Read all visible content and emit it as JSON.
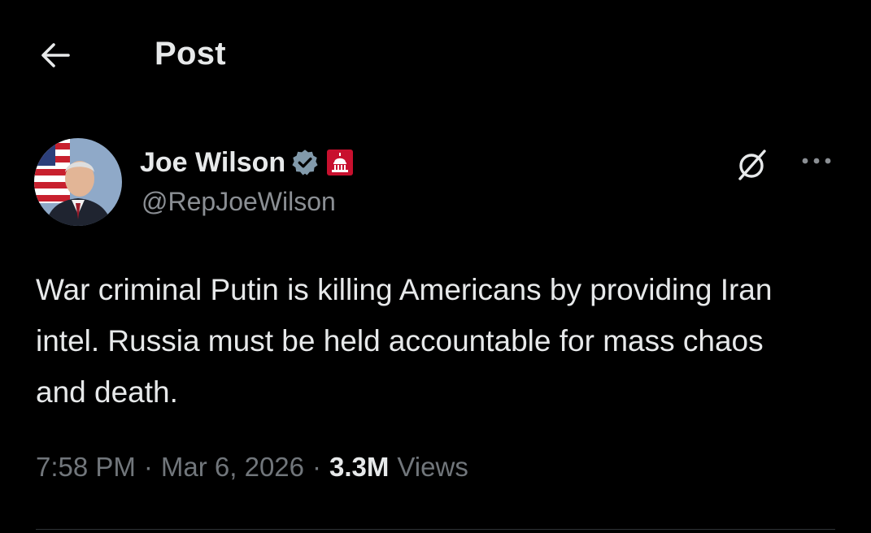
{
  "header": {
    "title": "Post",
    "back_icon": "arrow-left-icon"
  },
  "author": {
    "display_name": "Joe Wilson",
    "handle": "@RepJoeWilson",
    "verified_icon": "verified-badge-icon",
    "affiliation_icon": "us-capitol-badge-icon",
    "colors": {
      "verified_badge": "#829aab",
      "affiliation_badge": "#c8102e"
    }
  },
  "actions": {
    "grok_icon": "grok-icon",
    "more_icon": "more-horizontal-icon"
  },
  "post": {
    "text": "War criminal Putin is killing Americans by providing Iran intel. Russia must be held accountable for mass chaos and death."
  },
  "meta": {
    "time": "7:58 PM",
    "date": "Mar 6, 2026",
    "separator": "·",
    "views_count": "3.3M",
    "views_label": "Views"
  },
  "theme": {
    "background": "#000000",
    "text_primary": "#e7e9ea",
    "text_secondary": "#71767b"
  }
}
